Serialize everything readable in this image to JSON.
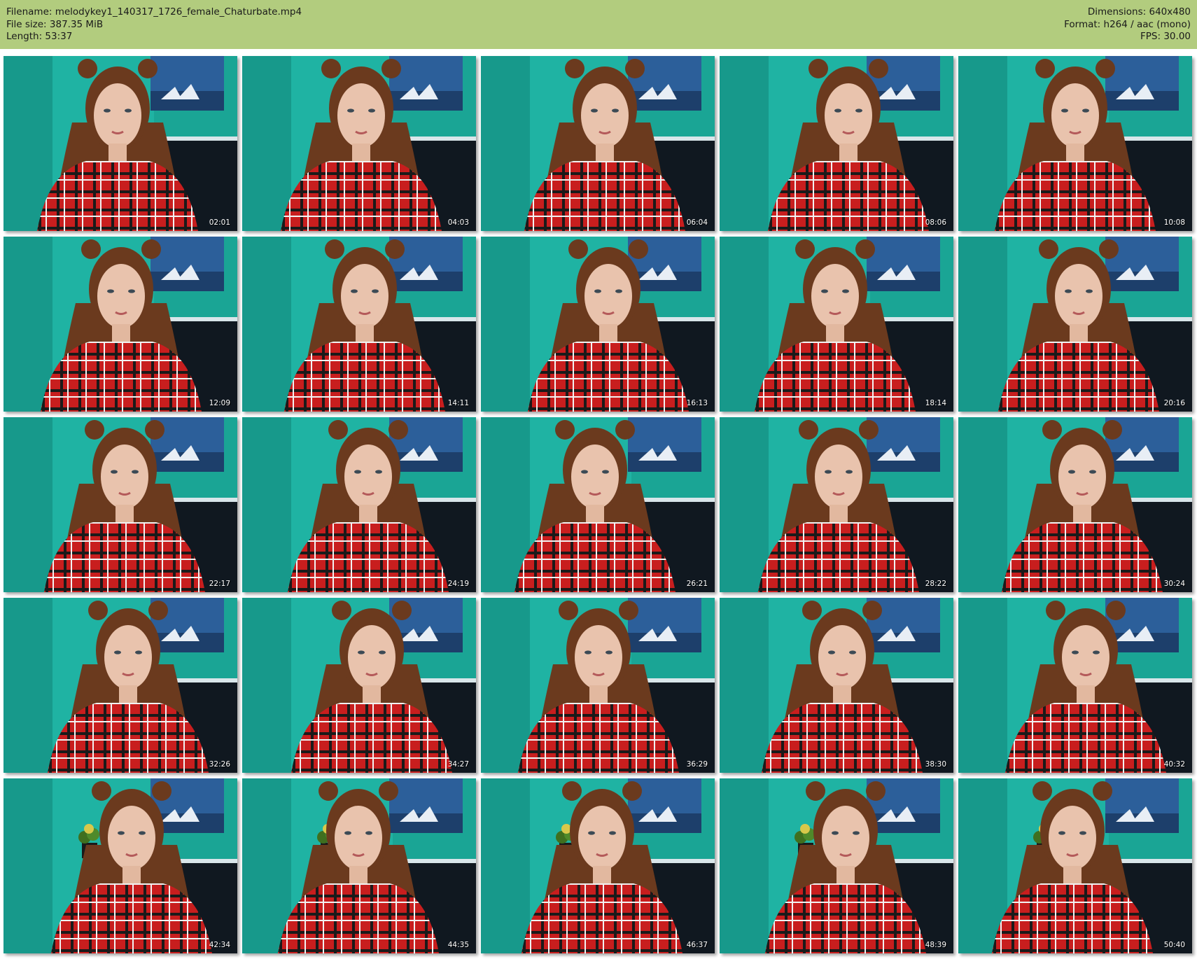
{
  "header": {
    "filename_line": "Filename: melodykey1_140317_1726_female_Chaturbate.mp4",
    "filesize_line": "File size: 387.35 MiB",
    "length_line": "Length: 53:37",
    "dimensions_line": "Dimensions: 640x480",
    "format_line": "Format: h264 / aac (mono)",
    "fps_line": "FPS: 30.00"
  },
  "colors": {
    "header_bg": "#b2cc7e",
    "wall": "#1fb3a3",
    "dress": "#c81e1e",
    "hair": "#6b3a1e"
  },
  "thumbnails": [
    {
      "timestamp": "02:01"
    },
    {
      "timestamp": "04:03"
    },
    {
      "timestamp": "06:04"
    },
    {
      "timestamp": "08:06"
    },
    {
      "timestamp": "10:08"
    },
    {
      "timestamp": "12:09"
    },
    {
      "timestamp": "14:11"
    },
    {
      "timestamp": "16:13"
    },
    {
      "timestamp": "18:14"
    },
    {
      "timestamp": "20:16"
    },
    {
      "timestamp": "22:17"
    },
    {
      "timestamp": "24:19"
    },
    {
      "timestamp": "26:21"
    },
    {
      "timestamp": "28:22"
    },
    {
      "timestamp": "30:24"
    },
    {
      "timestamp": "32:26"
    },
    {
      "timestamp": "34:27"
    },
    {
      "timestamp": "36:29"
    },
    {
      "timestamp": "38:30"
    },
    {
      "timestamp": "40:32"
    },
    {
      "timestamp": "42:34"
    },
    {
      "timestamp": "44:35"
    },
    {
      "timestamp": "46:37"
    },
    {
      "timestamp": "48:39"
    },
    {
      "timestamp": "50:40"
    }
  ]
}
